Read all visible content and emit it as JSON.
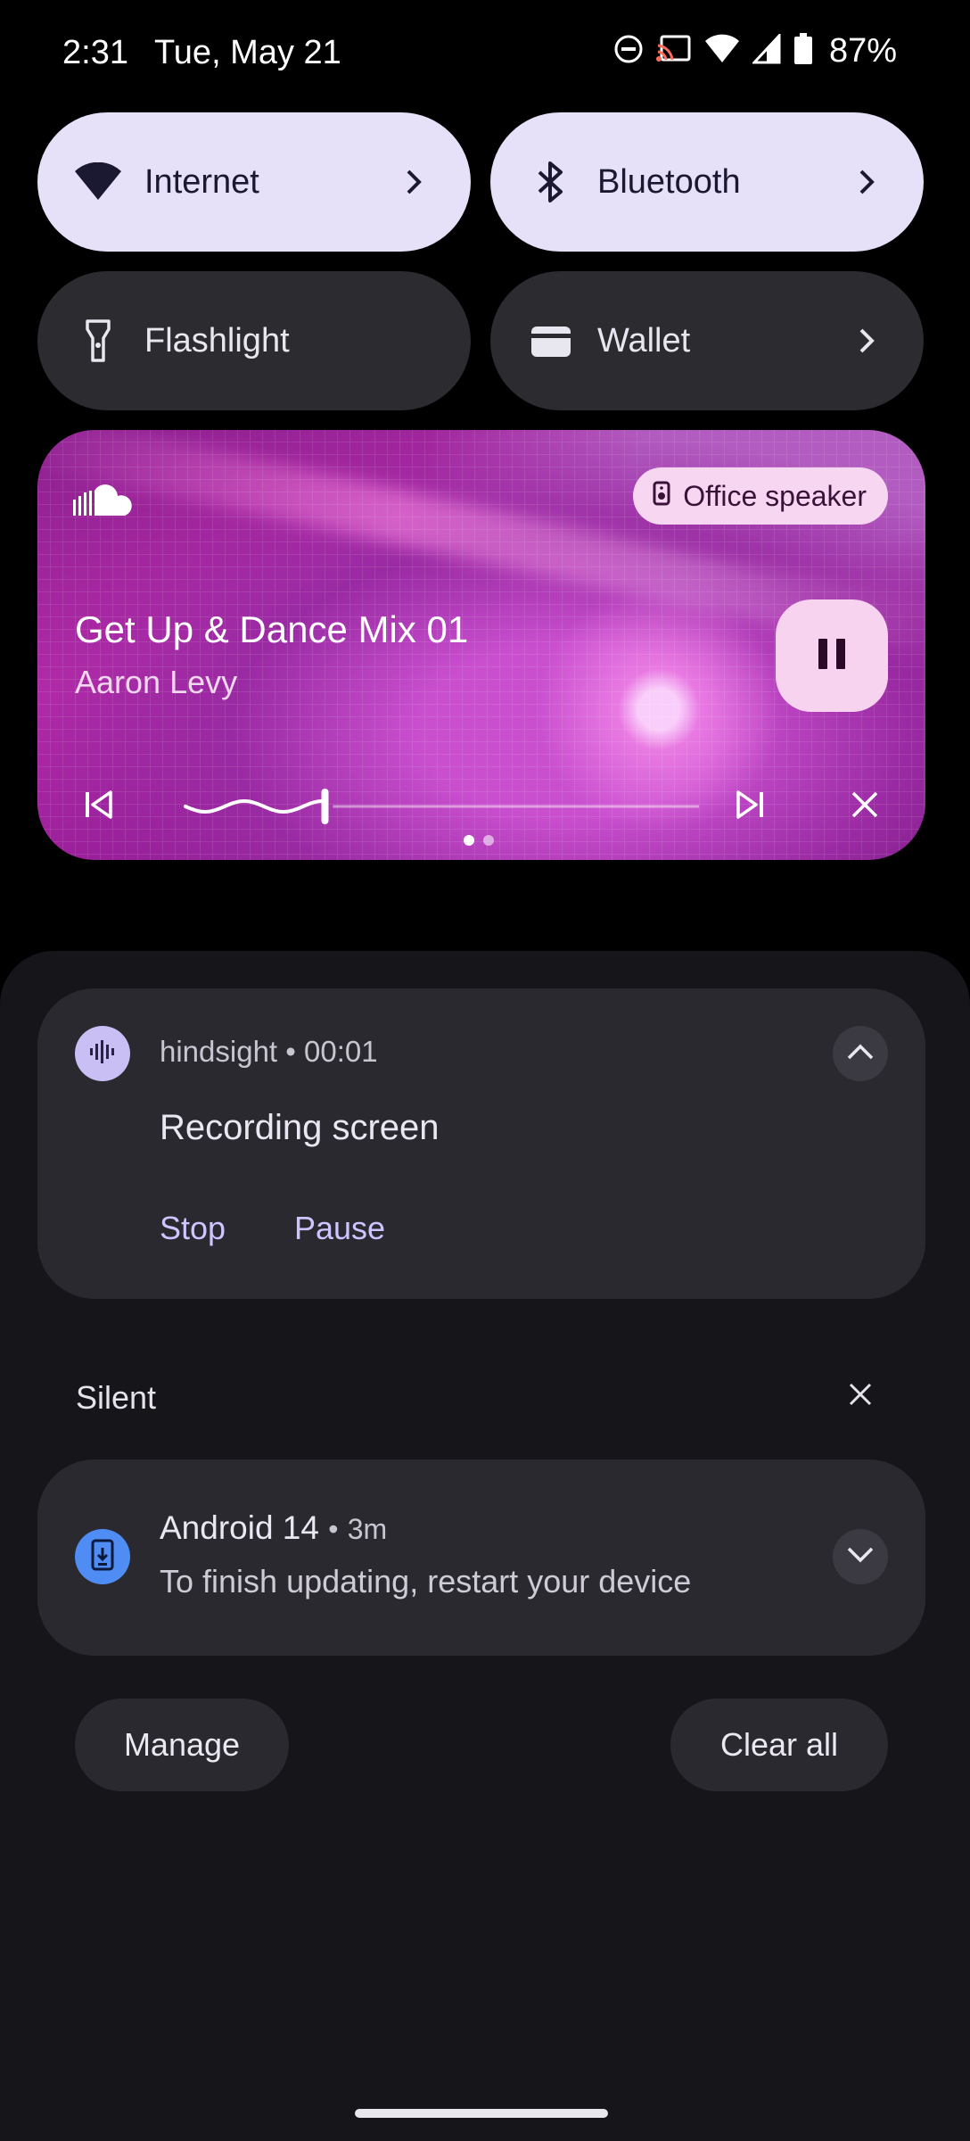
{
  "status_bar": {
    "time": "2:31",
    "date": "Tue, May 21",
    "battery_percent": "87%",
    "icons": [
      "do-not-disturb-icon",
      "cast-icon",
      "wifi-icon",
      "cellular-icon",
      "battery-icon"
    ]
  },
  "quick_settings": {
    "tiles": [
      {
        "label": "Internet",
        "icon": "wifi-icon",
        "active": true,
        "has_chevron": true
      },
      {
        "label": "Bluetooth",
        "icon": "bluetooth-icon",
        "active": true,
        "has_chevron": true
      },
      {
        "label": "Flashlight",
        "icon": "flashlight-icon",
        "active": false,
        "has_chevron": false
      },
      {
        "label": "Wallet",
        "icon": "wallet-icon",
        "active": false,
        "has_chevron": true
      }
    ]
  },
  "media": {
    "app_icon": "soundcloud-icon",
    "output_device": "Office speaker",
    "title": "Get Up & Dance Mix 01",
    "artist": "Aaron Levy",
    "state": "playing",
    "progress": 0.27,
    "page_count": 2,
    "current_page": 1
  },
  "notifications": {
    "recording": {
      "app_name": "hindsight",
      "separator": "•",
      "elapsed": "00:01",
      "title": "Recording screen",
      "actions": [
        "Stop",
        "Pause"
      ]
    },
    "silent_section": {
      "label": "Silent"
    },
    "update": {
      "app_title": "Android 14",
      "separator": "•",
      "when": "3m",
      "text": "To finish updating, restart your device"
    }
  },
  "footer": {
    "manage_label": "Manage",
    "clear_all_label": "Clear all"
  },
  "colors": {
    "tile_active": "#e6e0f8",
    "tile_inactive": "#2b2b30",
    "notification_bg": "#2a2930",
    "accent_text": "#cfc4ff",
    "media_chip": "#f7d6f2",
    "update_icon": "#4f8df5"
  }
}
